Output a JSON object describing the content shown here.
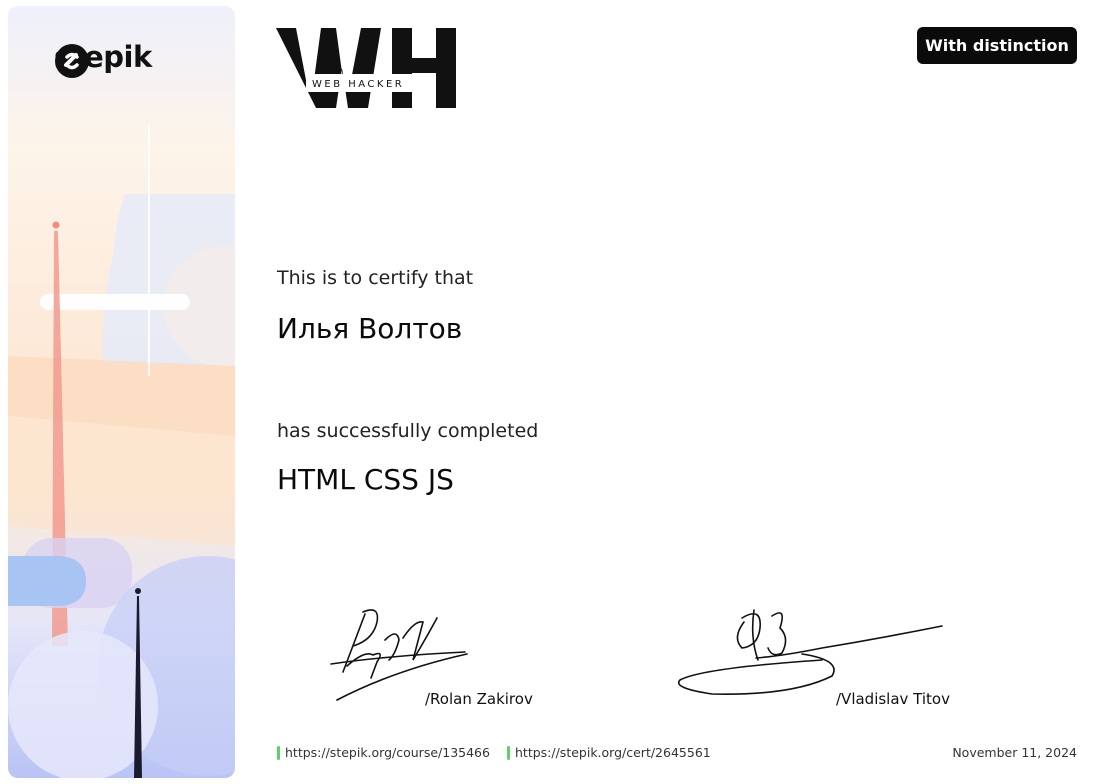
{
  "brand": {
    "name": "stepik",
    "icon": "stepik-logo-icon"
  },
  "partner_logo": {
    "letters": "WH",
    "caption": "WEB HACKER"
  },
  "badge": {
    "label": "With distinction"
  },
  "certificate": {
    "intro": "This is to certify that",
    "recipient": "Илья Волтов",
    "completed_text": "has successfully completed",
    "course": "HTML CSS JS"
  },
  "signatures": [
    {
      "name": "/Rolan Zakirov"
    },
    {
      "name": "/Vladislav Titov"
    }
  ],
  "footer": {
    "course_url": "https://stepik.org/course/135466",
    "cert_url": "https://stepik.org/cert/2645561",
    "date": "November 11, 2024",
    "link_mark_color": "#5fcf6a"
  },
  "colors": {
    "badge_bg": "#0b0b0b",
    "text": "#111111"
  }
}
